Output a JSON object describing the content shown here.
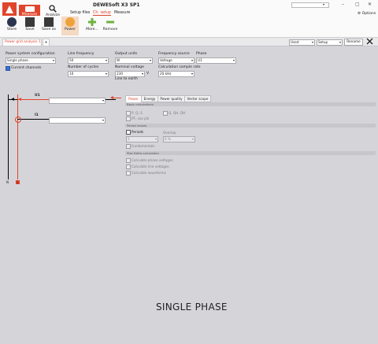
{
  "window": {
    "title": "DEWESoft X3 SP1",
    "search_placeholder": "",
    "minimize": "–",
    "maximize": "▢",
    "close": "✕",
    "options_label": "Options"
  },
  "modes": {
    "measure": "Measure",
    "analyze": "Analyze"
  },
  "tabs": [
    "Setup files",
    "Ch. setup",
    "Measure"
  ],
  "toolbar": {
    "store": "Store",
    "save": "Save",
    "save_as": "Save as",
    "power": "Power",
    "more": "More...",
    "remove": "Remove"
  },
  "doc": {
    "tab_label": "Power grid analysis 1",
    "plus": "+",
    "used_value": "Used",
    "setup_value": "Setup",
    "rename_label": "Rename"
  },
  "config": {
    "power_system_label": "Power system configuration",
    "power_system_value": "Single phase",
    "current_channels_label": "Current channels",
    "line_frequency_label": "Line frequency",
    "line_frequency_value": "50",
    "number_of_cycles_label": "Number of cycles",
    "number_of_cycles_value": "10",
    "output_units_label": "Output units",
    "output_units_value": "W",
    "nominal_voltage_label": "Nominal voltage",
    "nominal_voltage_value": "230",
    "nominal_voltage_unit": "V",
    "line_to_earth_label": "Line to earth",
    "frequency_source_label": "Frequency source",
    "frequency_source_value": "Voltage",
    "calc_sample_rate_label": "Calculation sample rate",
    "calc_sample_rate_value": "20 kHz",
    "phase_label": "Phase",
    "phase_value": "U1"
  },
  "diagram": {
    "u1": "U1",
    "i1": "I1",
    "n": "N",
    "l": "L"
  },
  "panel_tabs": [
    "Power",
    "Energy",
    "Power quality",
    "Vector scope"
  ],
  "basic": {
    "title": "Basic calculations",
    "pqs": "P, Q, S",
    "qh": "Q, QH, DH",
    "pf": "PF, cos phi"
  },
  "period": {
    "title": "Period values",
    "periods": "Periods",
    "overlap": "Overlap",
    "periods_value": "1",
    "overlap_value": "0 %",
    "fundamentals": "Fundamentals"
  },
  "stardelta": {
    "title": "Star-Delta calculation",
    "phase_voltages": "Calculate phase voltages",
    "line_voltages": "Calculate line voltages",
    "line_waveforms": "Calculate waveforms"
  },
  "caption": "SINGLE PHASE",
  "colors": {
    "accent": "#e0452c",
    "background": "#d5d5d9",
    "toolbar": "#fafafa"
  }
}
